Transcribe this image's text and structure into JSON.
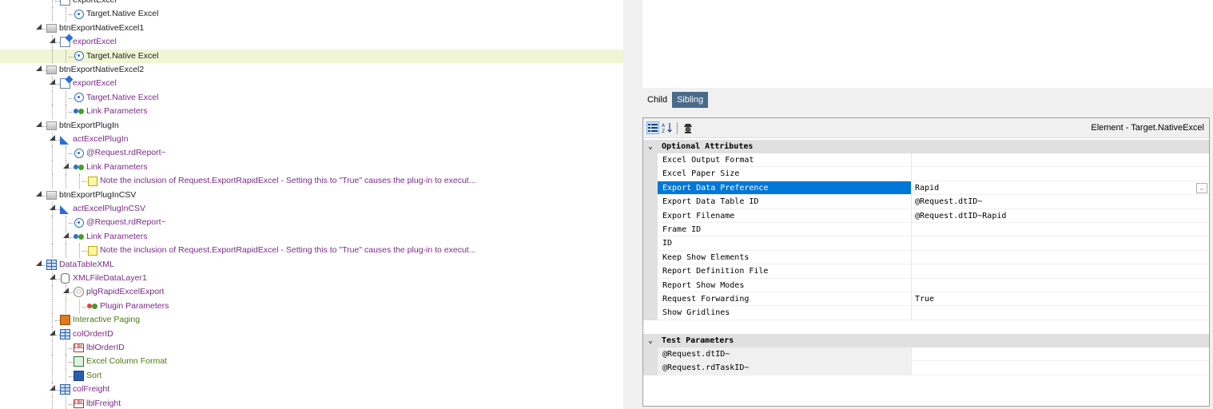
{
  "tree": {
    "rows": [
      {
        "label": "exportExcel",
        "icon": "export-icon",
        "color": "plain"
      },
      {
        "label": "Target.Native Excel",
        "icon": "target-icon",
        "color": "plain"
      },
      {
        "label": "btnExportNativeExcel1",
        "icon": "button-icon",
        "color": "plain"
      },
      {
        "label": "exportExcel",
        "icon": "export-icon",
        "color": "note"
      },
      {
        "label": "Target.Native Excel",
        "icon": "target-icon",
        "color": "plain",
        "selected": true
      },
      {
        "label": "btnExportNativeExcel2",
        "icon": "button-icon",
        "color": "plain"
      },
      {
        "label": "exportExcel",
        "icon": "export-icon",
        "color": "note"
      },
      {
        "label": "Target.Native Excel",
        "icon": "target-icon",
        "color": "note"
      },
      {
        "label": "Link Parameters",
        "icon": "link-params-icon",
        "color": "note"
      },
      {
        "label": "btnExportPlugIn",
        "icon": "button-icon",
        "color": "plain"
      },
      {
        "label": "actExcelPlugIn",
        "icon": "action-icon",
        "color": "note"
      },
      {
        "label": "@Request.rdReport~",
        "icon": "target-icon",
        "color": "note"
      },
      {
        "label": "Link Parameters",
        "icon": "link-params-icon",
        "color": "note"
      },
      {
        "label": "Note the inclusion of Request.ExportRapidExcel - Setting this to \"True\" causes the plug-in to execut...",
        "icon": "note-icon",
        "color": "note"
      },
      {
        "label": "btnExportPlugInCSV",
        "icon": "button-icon",
        "color": "plain"
      },
      {
        "label": "actExcelPlugInCSV",
        "icon": "action-icon",
        "color": "note"
      },
      {
        "label": "@Request.rdReport~",
        "icon": "target-icon",
        "color": "note"
      },
      {
        "label": "Link Parameters",
        "icon": "link-params-icon",
        "color": "note"
      },
      {
        "label": "Note the inclusion of Request.ExportRapidExcel - Setting this to \"True\" causes the plug-in to execut...",
        "icon": "note-icon",
        "color": "note"
      },
      {
        "label": "DataTableXML",
        "icon": "table-icon",
        "color": "note"
      },
      {
        "label": "XMLFileDataLayer1",
        "icon": "datalayer-icon",
        "color": "note"
      },
      {
        "label": "plgRapidExcelExport",
        "icon": "plugin-icon",
        "color": "note"
      },
      {
        "label": "Plugin Parameters",
        "icon": "plugin-params-icon",
        "color": "note"
      },
      {
        "label": "Interactive Paging",
        "icon": "paging-icon",
        "color": "green"
      },
      {
        "label": "colOrderID",
        "icon": "column-icon",
        "color": "note"
      },
      {
        "label": "lblOrderID",
        "icon": "label-icon",
        "color": "note"
      },
      {
        "label": "Excel Column Format",
        "icon": "excel-format-icon",
        "color": "green"
      },
      {
        "label": "Sort",
        "icon": "sort-icon",
        "color": "green"
      },
      {
        "label": "colFreight",
        "icon": "column-icon",
        "color": "note"
      },
      {
        "label": "lblFreight",
        "icon": "label-icon",
        "color": "note"
      }
    ]
  },
  "tabs": [
    {
      "label": "Child",
      "active": true
    },
    {
      "label": "Sibling",
      "active": false
    }
  ],
  "toolbar": {
    "categorized_icon": "categorized-icon",
    "alphabetical_icon": "alphabetical-sort-icon",
    "spy_icon": "spy-icon",
    "element_title": "Element - Target.NativeExcel"
  },
  "properties": {
    "optional_header": "Optional Attributes",
    "optional": [
      {
        "name": "Excel Output Format",
        "value": ""
      },
      {
        "name": "Excel Paper Size",
        "value": ""
      },
      {
        "name": "Export Data Preference",
        "value": "Rapid",
        "selected": true,
        "dropdown": true
      },
      {
        "name": "Export Data Table ID",
        "value": "@Request.dtID~"
      },
      {
        "name": "Export Filename",
        "value": "@Request.dtID~Rapid"
      },
      {
        "name": "Frame ID",
        "value": ""
      },
      {
        "name": "ID",
        "value": ""
      },
      {
        "name": "Keep Show Elements",
        "value": ""
      },
      {
        "name": "Report Definition File",
        "value": ""
      },
      {
        "name": "Report Show Modes",
        "value": ""
      },
      {
        "name": "Request Forwarding",
        "value": "True"
      },
      {
        "name": "Show Gridlines",
        "value": ""
      }
    ],
    "test_header": "Test Parameters",
    "test": [
      {
        "name": "@Request.dtID~",
        "value": ""
      },
      {
        "name": "@Request.rdTaskID~",
        "value": ""
      }
    ]
  },
  "colors": {
    "selection": "#0078d7",
    "tree_selected": "#f0f5d5",
    "inactive_tab": "#4a6a8a"
  }
}
